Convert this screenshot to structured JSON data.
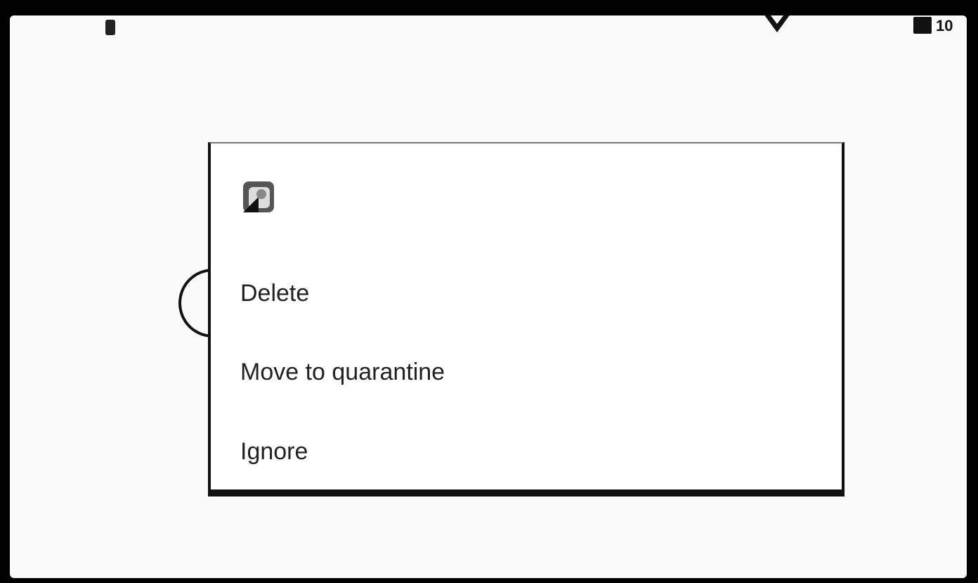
{
  "status_bar": {
    "time": "10",
    "icons": [
      "notification-icon",
      "wifi-icon",
      "battery-icon"
    ]
  },
  "dialog": {
    "icon": "threat-app-icon",
    "options": [
      {
        "label": "Delete"
      },
      {
        "label": "Move to quarantine"
      },
      {
        "label": "Ignore"
      }
    ]
  },
  "colors": {
    "background": "#fafafa",
    "dialog": "#ffffff",
    "text": "#222222"
  }
}
